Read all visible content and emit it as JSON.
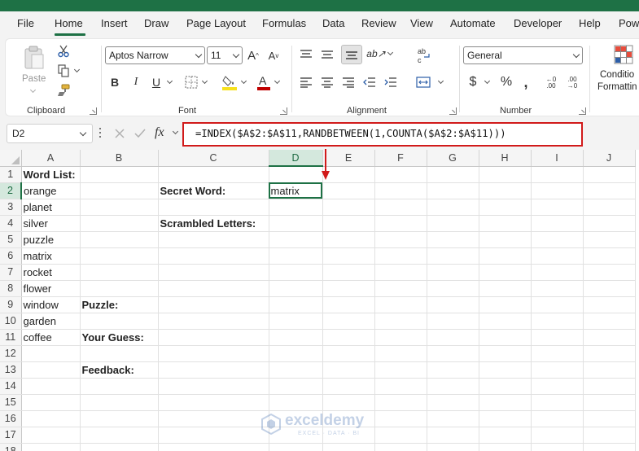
{
  "tabs": [
    "File",
    "Home",
    "Insert",
    "Draw",
    "Page Layout",
    "Formulas",
    "Data",
    "Review",
    "View",
    "Automate",
    "Developer",
    "Help",
    "Pow"
  ],
  "active_tab": "Home",
  "ribbon": {
    "clipboard": {
      "label": "Clipboard",
      "paste_label": "Paste"
    },
    "font": {
      "label": "Font",
      "font_name": "Aptos Narrow",
      "font_size": "11"
    },
    "alignment": {
      "label": "Alignment"
    },
    "number": {
      "label": "Number",
      "format": "General"
    },
    "styles": {
      "conditional_line1": "Conditio",
      "conditional_line2": "Formattin"
    },
    "colors": {
      "accent": "#1e7145",
      "highlight": "#f7e11c",
      "font_color": "#c00000",
      "annotation": "#d11a1a"
    }
  },
  "formula_bar": {
    "name_box": "D2",
    "fx": "fx",
    "formula": "=INDEX($A$2:$A$11,RANDBETWEEN(1,COUNTA($A$2:$A$11)))"
  },
  "columns": [
    "A",
    "B",
    "C",
    "D",
    "E",
    "F",
    "G",
    "H",
    "I",
    "J"
  ],
  "selected_column": "D",
  "selected_row": 2,
  "rows": [
    {
      "n": "1",
      "A": "Word List:",
      "B": "",
      "C": "",
      "D": ""
    },
    {
      "n": "2",
      "A": "orange",
      "B": "",
      "C": "Secret Word:",
      "D": "matrix"
    },
    {
      "n": "3",
      "A": "planet",
      "B": "",
      "C": "",
      "D": ""
    },
    {
      "n": "4",
      "A": "silver",
      "B": "",
      "C": "Scrambled Letters:",
      "D": ""
    },
    {
      "n": "5",
      "A": "puzzle",
      "B": "",
      "C": "",
      "D": ""
    },
    {
      "n": "6",
      "A": "matrix",
      "B": "",
      "C": "",
      "D": ""
    },
    {
      "n": "7",
      "A": "rocket",
      "B": "",
      "C": "",
      "D": ""
    },
    {
      "n": "8",
      "A": "flower",
      "B": "",
      "C": "",
      "D": ""
    },
    {
      "n": "9",
      "A": "window",
      "B": "Puzzle:",
      "C": "",
      "D": ""
    },
    {
      "n": "10",
      "A": "garden",
      "B": "",
      "C": "",
      "D": ""
    },
    {
      "n": "11",
      "A": "coffee",
      "B": "Your Guess:",
      "C": "",
      "D": ""
    },
    {
      "n": "12",
      "A": "",
      "B": "",
      "C": "",
      "D": ""
    },
    {
      "n": "13",
      "A": "",
      "B": "Feedback:",
      "C": "",
      "D": ""
    },
    {
      "n": "14",
      "A": "",
      "B": "",
      "C": "",
      "D": ""
    },
    {
      "n": "15",
      "A": "",
      "B": "",
      "C": "",
      "D": ""
    },
    {
      "n": "16",
      "A": "",
      "B": "",
      "C": "",
      "D": ""
    },
    {
      "n": "17",
      "A": "",
      "B": "",
      "C": "",
      "D": ""
    },
    {
      "n": "18",
      "A": "",
      "B": "",
      "C": "",
      "D": ""
    }
  ],
  "bold_cells": [
    "A1",
    "C2",
    "C4",
    "B9",
    "B11",
    "B13"
  ],
  "watermark": {
    "brand": "exceldemy",
    "tagline": "EXCEL · DATA · BI"
  }
}
